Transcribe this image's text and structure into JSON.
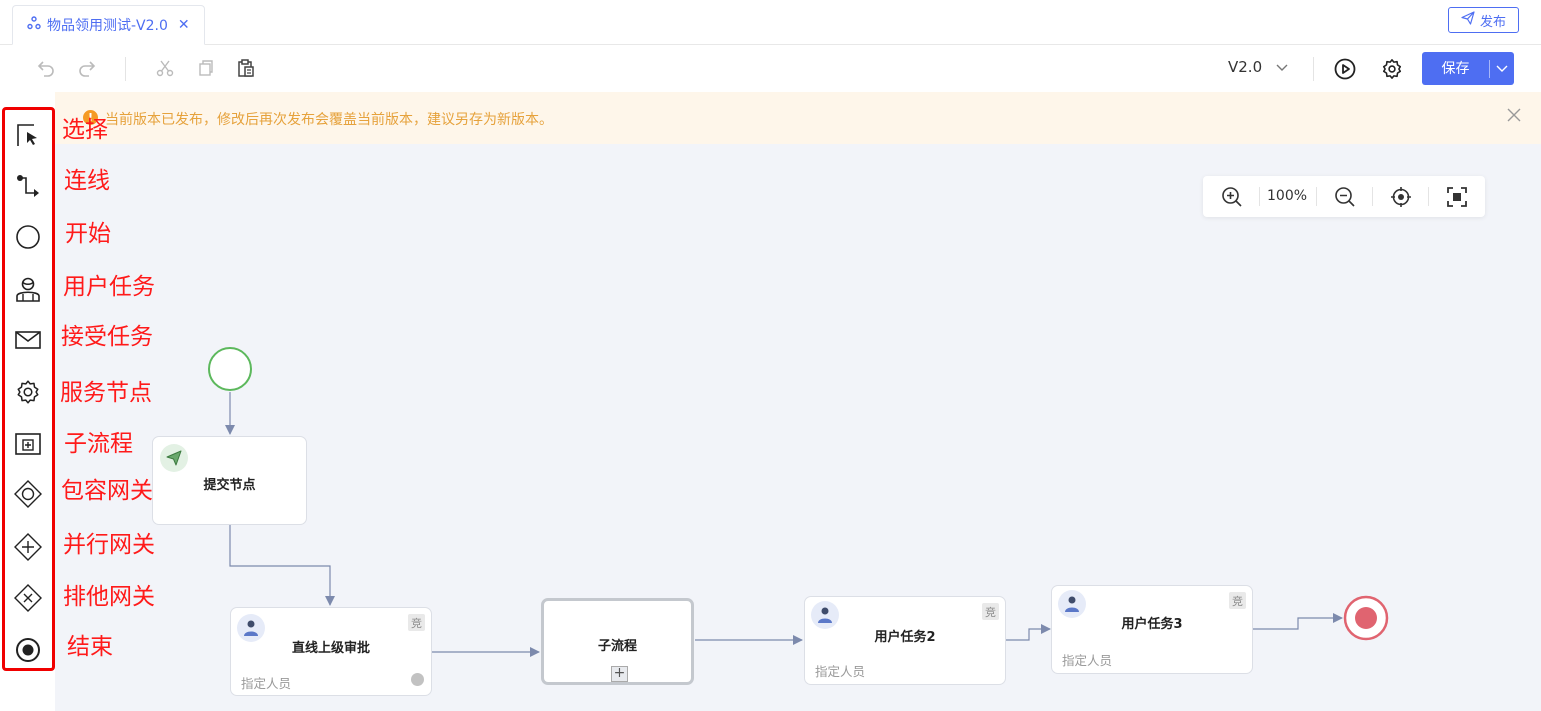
{
  "tab": {
    "title": "物品领用测试-V2.0",
    "close": "✕"
  },
  "header": {
    "publish_label": "发布"
  },
  "toolbar": {
    "version": "V2.0",
    "save_label": "保存"
  },
  "alert": {
    "message": "当前版本已发布，修改后再次发布会覆盖当前版本，建议另存为新版本。"
  },
  "zoom": {
    "level": "100%"
  },
  "palette": {
    "items": [
      {
        "label": "选择",
        "icon": "select-cursor-icon"
      },
      {
        "label": "连线",
        "icon": "connect-line-icon"
      },
      {
        "label": "开始",
        "icon": "start-event-icon"
      },
      {
        "label": "用户任务",
        "icon": "user-task-icon"
      },
      {
        "label": "接受任务",
        "icon": "receive-task-icon"
      },
      {
        "label": "服务节点",
        "icon": "service-task-icon"
      },
      {
        "label": "子流程",
        "icon": "subprocess-icon"
      },
      {
        "label": "包容网关",
        "icon": "inclusive-gateway-icon"
      },
      {
        "label": "并行网关",
        "icon": "parallel-gateway-icon"
      },
      {
        "label": "排他网关",
        "icon": "exclusive-gateway-icon"
      },
      {
        "label": "结束",
        "icon": "end-event-icon"
      }
    ]
  },
  "diagram": {
    "submit_node": {
      "title": "提交节点"
    },
    "approval_node": {
      "title": "直线上级审批",
      "badge": "竞",
      "assignee": "指定人员"
    },
    "subprocess_node": {
      "title": "子流程",
      "marker": "+"
    },
    "user_task2": {
      "title": "用户任务2",
      "badge": "竞",
      "assignee": "指定人员"
    },
    "user_task3": {
      "title": "用户任务3",
      "badge": "竞",
      "assignee": "指定人员"
    }
  },
  "colors": {
    "accent": "#4e6ef2",
    "start": "#5cb85c",
    "end": "#e06470",
    "annotation": "#ff1a1a",
    "alert_text": "#e6a23c"
  }
}
